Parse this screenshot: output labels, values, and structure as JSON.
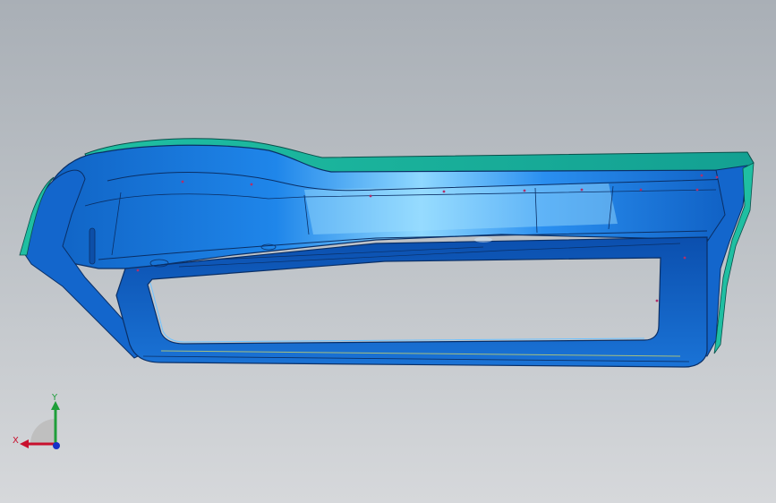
{
  "viewport": {
    "background_top": "#a9afb6",
    "background_bottom": "#d6d8db"
  },
  "model": {
    "primary_color": "#1a7fe6",
    "highlight_color": "#7fd0ff",
    "edge_color": "#0a2f66",
    "flange_color": "#18b7a0",
    "hole_color": "#b0306a"
  },
  "triad": {
    "x_label": "X",
    "y_label": "Y",
    "x_color": "#c8102e",
    "y_color": "#1f9e3a",
    "z_color": "#1530c8"
  }
}
